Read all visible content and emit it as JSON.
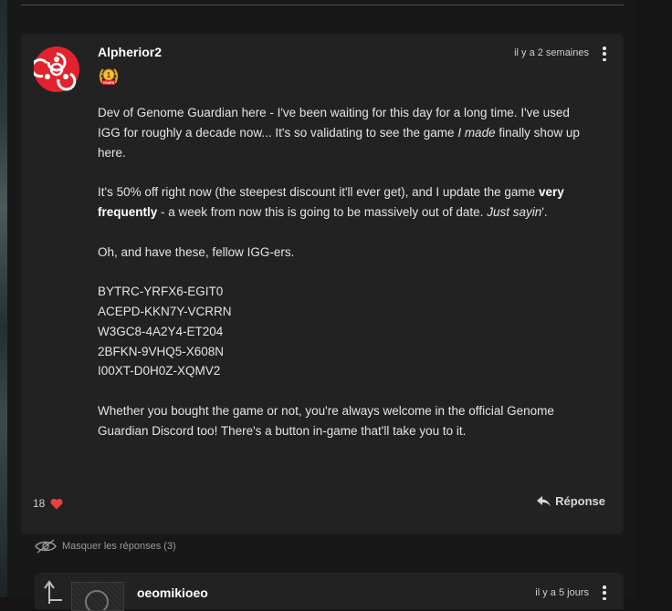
{
  "colors": {
    "accent_red": "#e2232e",
    "heart_red": "#e8413c",
    "card_bg": "#222222",
    "page_bg": "#181818"
  },
  "comment": {
    "username": "Alpherior2",
    "badge_icon": "1-year-laurel-badge-icon",
    "badge_text": "1",
    "badge_label": "YEARS",
    "timestamp": "il y a 2 semaines",
    "paragraph1": "Dev of Genome Guardian here - I've been waiting for this day for a long time. I've used IGG for roughly a decade now... It's so validating to see the game ",
    "paragraph1_em": "I made",
    "paragraph1_end": " finally show up here.",
    "paragraph2_start": "It's 50% off right now (the steepest discount it'll ever get), and I update the game ",
    "paragraph2_bold": "very frequently",
    "paragraph2_mid": " - a week from now this is going to be massively out of date. ",
    "paragraph2_em": "Just sayin",
    "paragraph2_end": "'.",
    "paragraph3": "Oh, and have these, fellow IGG-ers.",
    "keys": [
      "BYTRC-YRFX6-EGIT0",
      "ACEPD-KKN7Y-VCRRN",
      "W3GC8-4A2Y4-ET204",
      "2BFKN-9VHQ5-X608N",
      "I00XT-D0H0Z-XQMV2"
    ],
    "paragraph4": "Whether you bought the game or not, you're always welcome in the official Genome Guardian Discord too! There's a button in-game that'll take you to it.",
    "like_count": "18",
    "reply_label": "Réponse"
  },
  "hide_replies_label": "Masquer les réponses (3)",
  "reply": {
    "username": "oeomikioeo",
    "timestamp": "il y a 5 jours"
  }
}
